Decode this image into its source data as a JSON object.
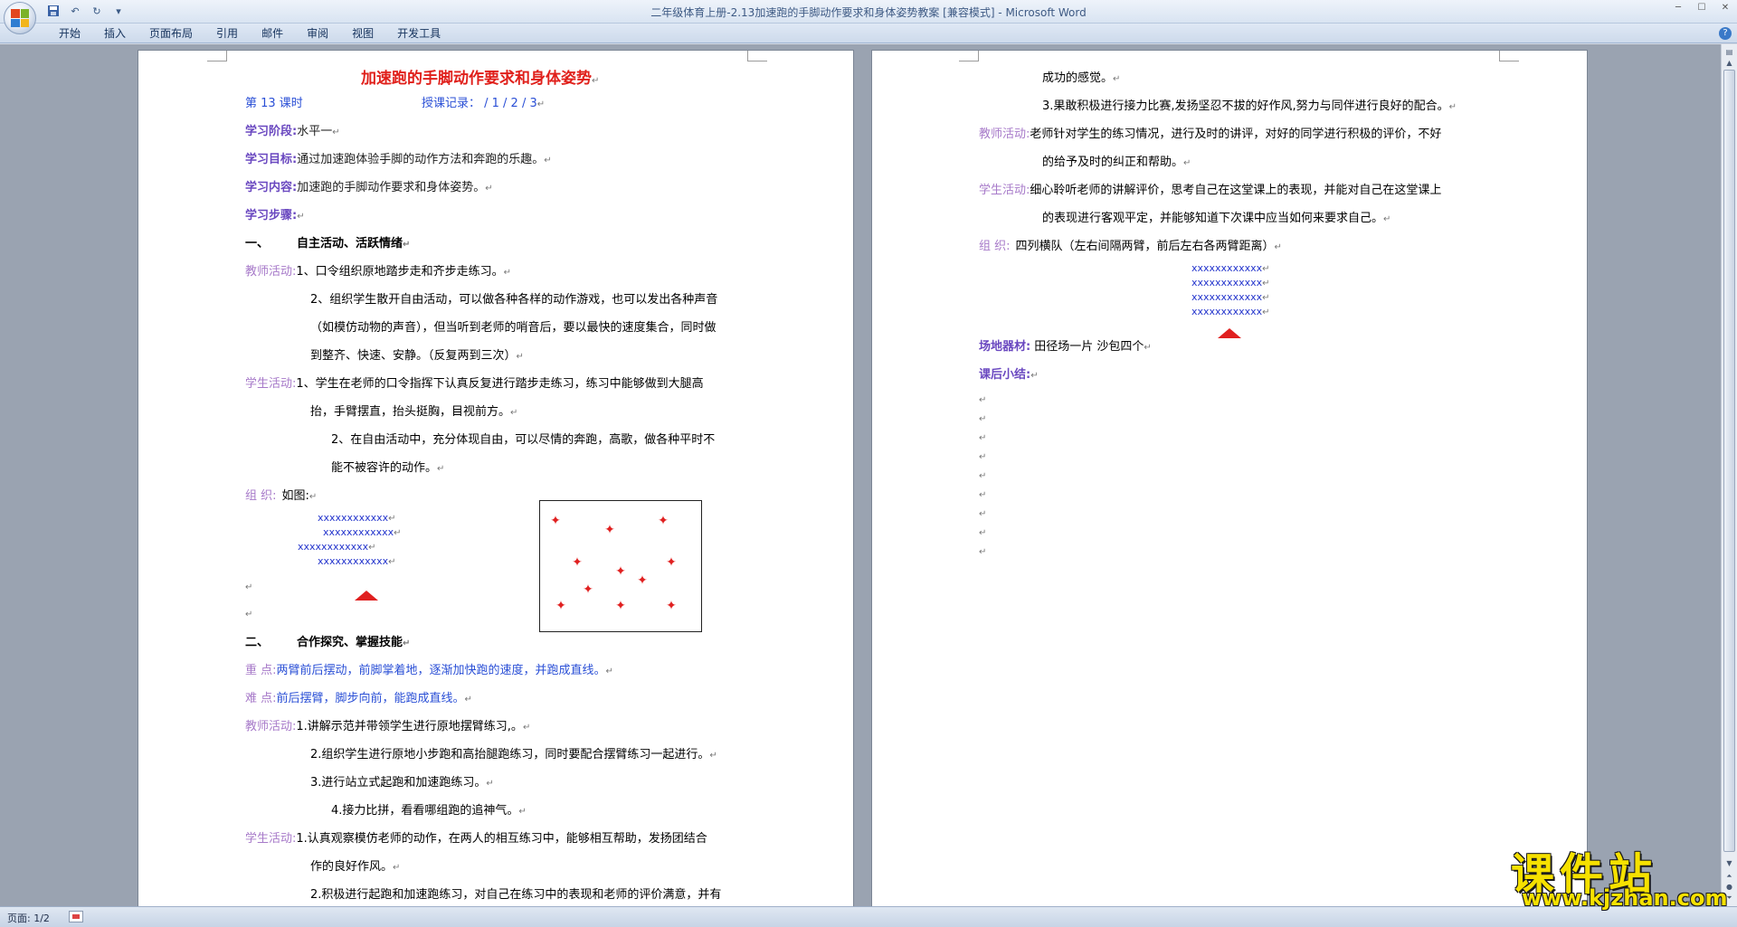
{
  "window": {
    "title": "二年级体育上册-2.13加速跑的手脚动作要求和身体姿势教案 [兼容模式] - Microsoft Word"
  },
  "ribbon": {
    "tabs": [
      "开始",
      "插入",
      "页面布局",
      "引用",
      "邮件",
      "审阅",
      "视图",
      "开发工具"
    ]
  },
  "left_page": {
    "title": "加速跑的手脚动作要求和身体姿势",
    "lesson": "第 13 课时",
    "record": "授课记录：  /  1    /  2    /  3",
    "stage_label": "学习阶段:",
    "stage_value": "水平一",
    "goal_label": "学习目标:",
    "goal_value": "通过加速跑体验手脚的动作方法和奔跑的乐趣。",
    "content_label": "学习内容:",
    "content_value": "加速跑的手脚动作要求和身体姿势。",
    "steps_label": "学习步骤:",
    "section1_num": "一、",
    "section1_title": "自主活动、活跃情绪",
    "teacher_label": "教师活动:",
    "t1": "1、口令组织原地踏步走和齐步走练习。",
    "t2a": "2、组织学生散开自由活动，可以做各种各样的动作游戏，也可以发出各种声音",
    "t2b": "（如模仿动物的声音），但当听到老师的哨音后，要以最快的速度集合，同时做",
    "t2c": "到整齐、快速、安静。（反复两到三次）",
    "student_label": "学生活动:",
    "s1a": "1、学生在老师的口令指挥下认真反复进行踏步走练习，练习中能够做到大腿高",
    "s1b": "抬，手臂摆直，抬头挺胸，目视前方。",
    "s2a": "2、在自由活动中，充分体现自由，可以尽情的奔跑，高歌，做各种平时不",
    "s2b": "能不被容许的动作。",
    "org_label": "组     织:",
    "org_value": "如图:",
    "formation": [
      "xxxxxxxxxxxx",
      "xxxxxxxxxxxx",
      "xxxxxxxxxxxx",
      "xxxxxxxxxxxx"
    ],
    "section2_num": "二、",
    "section2_title": "合作探究、掌握技能",
    "key_label": "重     点:",
    "key_value": "两臂前后摆动，前脚掌着地，逐渐加快跑的速度，并跑成直线。",
    "diff_label": "难     点:",
    "diff_value": "前后摆臂，脚步向前，能跑成直线。",
    "teacher2_label": "教师活动:",
    "tt1": "1.讲解示范并带领学生进行原地摆臂练习,。",
    "tt2": "2.组织学生进行原地小步跑和高抬腿跑练习，同时要配合摆臂练习一起进行。",
    "tt3": "3.进行站立式起跑和加速跑练习。",
    "tt4": "4.接力比拼，看看哪组跑的追神气。",
    "student2_label": "学生活动:",
    "ss1a": "1.认真观察模仿老师的动作，在两人的相互练习中，能够相互帮助，发扬团结合",
    "ss1b": "作的良好作风。",
    "ss2a": "2.积极进行起跑和加速跑练习，对自己在练习中的表现和老师的评价满意，并有"
  },
  "right_page": {
    "r1": "成功的感觉。",
    "r2": "3.果敢积极进行接力比赛,发扬坚忍不拔的好作风,努力与同伴进行良好的配合。",
    "teacher_label": "教师活动:",
    "t1a": "老师针对学生的练习情况，进行及时的讲评，对好的同学进行积极的评价，不好",
    "t1b": "的给予及时的纠正和帮助。",
    "student_label": "学生活动:",
    "s1a": "细心聆听老师的讲解评价，思考自己在这堂课上的表现，并能对自己在这堂课上",
    "s1b": "的表现进行客观平定，并能够知道下次课中应当如何来要求自己。",
    "org_label": "组     织:",
    "org_value": "四列横队（左右间隔两臂，前后左右各两臂距离）",
    "formation": [
      "xxxxxxxxxxxx",
      "xxxxxxxxxxxx",
      "xxxxxxxxxxxx",
      "xxxxxxxxxxxx"
    ],
    "venue_label": "场地器材:",
    "venue_value": "田径场一片      沙包四个",
    "summary_label": "课后小结:"
  },
  "statusbar": {
    "page": "页面: 1/2"
  },
  "watermark": {
    "main": "课件站",
    "url": "www.kjzhan.com"
  },
  "colors": {
    "label_purple": "#a77ac9",
    "blue_text": "#2a4fd6",
    "red_title": "#e0201b",
    "watermark_yellow": "#f6e100"
  }
}
